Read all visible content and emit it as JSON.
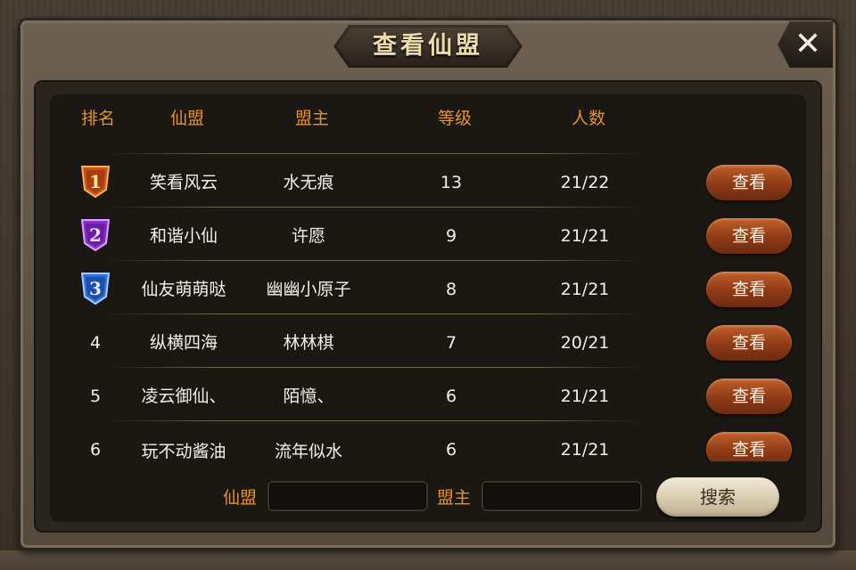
{
  "title": "查看仙盟",
  "close_icon": "close-icon",
  "headers": {
    "rank": "排名",
    "alliance": "仙盟",
    "leader": "盟主",
    "level": "等级",
    "members": "人数"
  },
  "rows": [
    {
      "rank": "1",
      "alliance": "笑看风云",
      "leader": "水无痕",
      "level": "13",
      "members": "21/22",
      "action": "查看"
    },
    {
      "rank": "2",
      "alliance": "和谐小仙",
      "leader": "许愿",
      "level": "9",
      "members": "21/21",
      "action": "查看"
    },
    {
      "rank": "3",
      "alliance": "仙友萌萌哒",
      "leader": "幽幽小原子",
      "level": "8",
      "members": "21/21",
      "action": "查看"
    },
    {
      "rank": "4",
      "alliance": "纵横四海",
      "leader": "林林棋",
      "level": "7",
      "members": "20/21",
      "action": "查看"
    },
    {
      "rank": "5",
      "alliance": "凌云御仙、",
      "leader": "陌憶、",
      "level": "6",
      "members": "21/21",
      "action": "查看"
    },
    {
      "rank": "6",
      "alliance": "玩不动酱油",
      "leader": "流年似水",
      "level": "6",
      "members": "21/21",
      "action": "查看"
    }
  ],
  "rank_badge_colors": {
    "1": "#c8541c",
    "2": "#8a2fc4",
    "3": "#2f6fd6"
  },
  "search": {
    "alliance_label": "仙盟",
    "alliance_value": "",
    "leader_label": "盟主",
    "leader_value": "",
    "button_label": "搜索"
  }
}
